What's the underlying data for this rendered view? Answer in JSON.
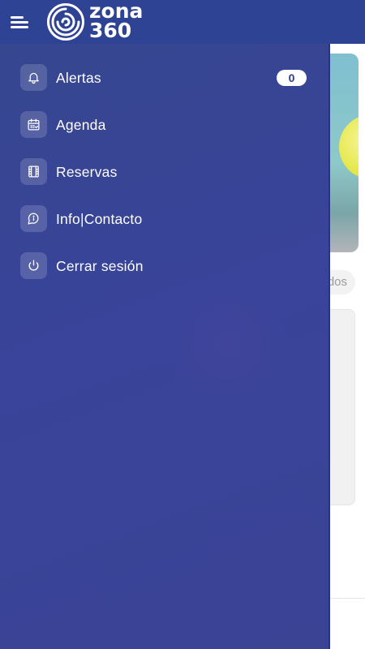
{
  "app": {
    "logo_text_line1": "zona",
    "logo_text_line2": "360"
  },
  "background": {
    "filter_pill_fragment": "dos"
  },
  "drawer": {
    "items": [
      {
        "label": "Alertas",
        "icon": "bell-icon",
        "badge": "0"
      },
      {
        "label": "Agenda",
        "icon": "calendar-icon"
      },
      {
        "label": "Reservas",
        "icon": "film-icon"
      },
      {
        "label": "Info|Contacto",
        "icon": "chat-info-icon"
      },
      {
        "label": "Cerrar sesión",
        "icon": "power-icon"
      }
    ]
  },
  "colors": {
    "appbar": "#2f4395",
    "drawer": "#39449a",
    "badge_text": "#2d3c8a"
  }
}
